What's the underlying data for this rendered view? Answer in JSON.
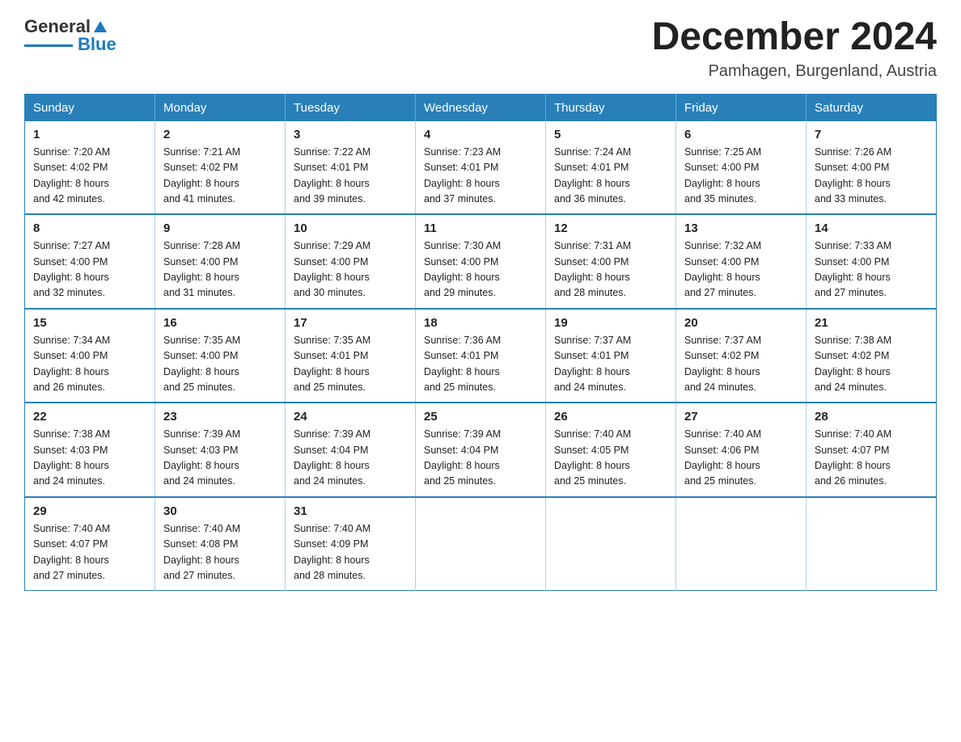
{
  "logo": {
    "general": "General",
    "blue": "Blue"
  },
  "title": "December 2024",
  "location": "Pamhagen, Burgenland, Austria",
  "days_of_week": [
    "Sunday",
    "Monday",
    "Tuesday",
    "Wednesday",
    "Thursday",
    "Friday",
    "Saturday"
  ],
  "weeks": [
    [
      {
        "day": "1",
        "sunrise": "7:20 AM",
        "sunset": "4:02 PM",
        "daylight": "8 hours and 42 minutes."
      },
      {
        "day": "2",
        "sunrise": "7:21 AM",
        "sunset": "4:02 PM",
        "daylight": "8 hours and 41 minutes."
      },
      {
        "day": "3",
        "sunrise": "7:22 AM",
        "sunset": "4:01 PM",
        "daylight": "8 hours and 39 minutes."
      },
      {
        "day": "4",
        "sunrise": "7:23 AM",
        "sunset": "4:01 PM",
        "daylight": "8 hours and 37 minutes."
      },
      {
        "day": "5",
        "sunrise": "7:24 AM",
        "sunset": "4:01 PM",
        "daylight": "8 hours and 36 minutes."
      },
      {
        "day": "6",
        "sunrise": "7:25 AM",
        "sunset": "4:00 PM",
        "daylight": "8 hours and 35 minutes."
      },
      {
        "day": "7",
        "sunrise": "7:26 AM",
        "sunset": "4:00 PM",
        "daylight": "8 hours and 33 minutes."
      }
    ],
    [
      {
        "day": "8",
        "sunrise": "7:27 AM",
        "sunset": "4:00 PM",
        "daylight": "8 hours and 32 minutes."
      },
      {
        "day": "9",
        "sunrise": "7:28 AM",
        "sunset": "4:00 PM",
        "daylight": "8 hours and 31 minutes."
      },
      {
        "day": "10",
        "sunrise": "7:29 AM",
        "sunset": "4:00 PM",
        "daylight": "8 hours and 30 minutes."
      },
      {
        "day": "11",
        "sunrise": "7:30 AM",
        "sunset": "4:00 PM",
        "daylight": "8 hours and 29 minutes."
      },
      {
        "day": "12",
        "sunrise": "7:31 AM",
        "sunset": "4:00 PM",
        "daylight": "8 hours and 28 minutes."
      },
      {
        "day": "13",
        "sunrise": "7:32 AM",
        "sunset": "4:00 PM",
        "daylight": "8 hours and 27 minutes."
      },
      {
        "day": "14",
        "sunrise": "7:33 AM",
        "sunset": "4:00 PM",
        "daylight": "8 hours and 27 minutes."
      }
    ],
    [
      {
        "day": "15",
        "sunrise": "7:34 AM",
        "sunset": "4:00 PM",
        "daylight": "8 hours and 26 minutes."
      },
      {
        "day": "16",
        "sunrise": "7:35 AM",
        "sunset": "4:00 PM",
        "daylight": "8 hours and 25 minutes."
      },
      {
        "day": "17",
        "sunrise": "7:35 AM",
        "sunset": "4:01 PM",
        "daylight": "8 hours and 25 minutes."
      },
      {
        "day": "18",
        "sunrise": "7:36 AM",
        "sunset": "4:01 PM",
        "daylight": "8 hours and 25 minutes."
      },
      {
        "day": "19",
        "sunrise": "7:37 AM",
        "sunset": "4:01 PM",
        "daylight": "8 hours and 24 minutes."
      },
      {
        "day": "20",
        "sunrise": "7:37 AM",
        "sunset": "4:02 PM",
        "daylight": "8 hours and 24 minutes."
      },
      {
        "day": "21",
        "sunrise": "7:38 AM",
        "sunset": "4:02 PM",
        "daylight": "8 hours and 24 minutes."
      }
    ],
    [
      {
        "day": "22",
        "sunrise": "7:38 AM",
        "sunset": "4:03 PM",
        "daylight": "8 hours and 24 minutes."
      },
      {
        "day": "23",
        "sunrise": "7:39 AM",
        "sunset": "4:03 PM",
        "daylight": "8 hours and 24 minutes."
      },
      {
        "day": "24",
        "sunrise": "7:39 AM",
        "sunset": "4:04 PM",
        "daylight": "8 hours and 24 minutes."
      },
      {
        "day": "25",
        "sunrise": "7:39 AM",
        "sunset": "4:04 PM",
        "daylight": "8 hours and 25 minutes."
      },
      {
        "day": "26",
        "sunrise": "7:40 AM",
        "sunset": "4:05 PM",
        "daylight": "8 hours and 25 minutes."
      },
      {
        "day": "27",
        "sunrise": "7:40 AM",
        "sunset": "4:06 PM",
        "daylight": "8 hours and 25 minutes."
      },
      {
        "day": "28",
        "sunrise": "7:40 AM",
        "sunset": "4:07 PM",
        "daylight": "8 hours and 26 minutes."
      }
    ],
    [
      {
        "day": "29",
        "sunrise": "7:40 AM",
        "sunset": "4:07 PM",
        "daylight": "8 hours and 27 minutes."
      },
      {
        "day": "30",
        "sunrise": "7:40 AM",
        "sunset": "4:08 PM",
        "daylight": "8 hours and 27 minutes."
      },
      {
        "day": "31",
        "sunrise": "7:40 AM",
        "sunset": "4:09 PM",
        "daylight": "8 hours and 28 minutes."
      },
      null,
      null,
      null,
      null
    ]
  ],
  "labels": {
    "sunrise": "Sunrise:",
    "sunset": "Sunset:",
    "daylight": "Daylight:"
  }
}
